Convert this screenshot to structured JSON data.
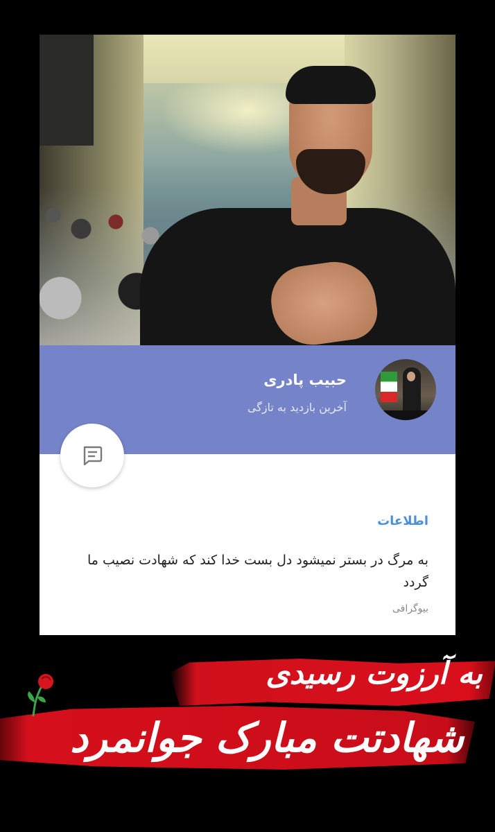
{
  "profile": {
    "name": "حبیب پادری",
    "last_seen": "آخرین بازدید به تازگی",
    "avatar_caption": "",
    "info_title": "اطلاعات",
    "bio": "به مرگ در بستر نمیشود دل بست خدا کند که شهادت نصیب ما گردد",
    "bio_label": "بیوگرافی"
  },
  "overlay_text": {
    "line1": "به آرزوت رسیدی",
    "line2": "شهادتت مبارک جوانمرد"
  },
  "icons": {
    "message": "message-icon",
    "rose": "rose-icon"
  },
  "colors": {
    "header": "#7584c8",
    "info_title": "#4a90d8",
    "brush": "#d60f1c"
  }
}
